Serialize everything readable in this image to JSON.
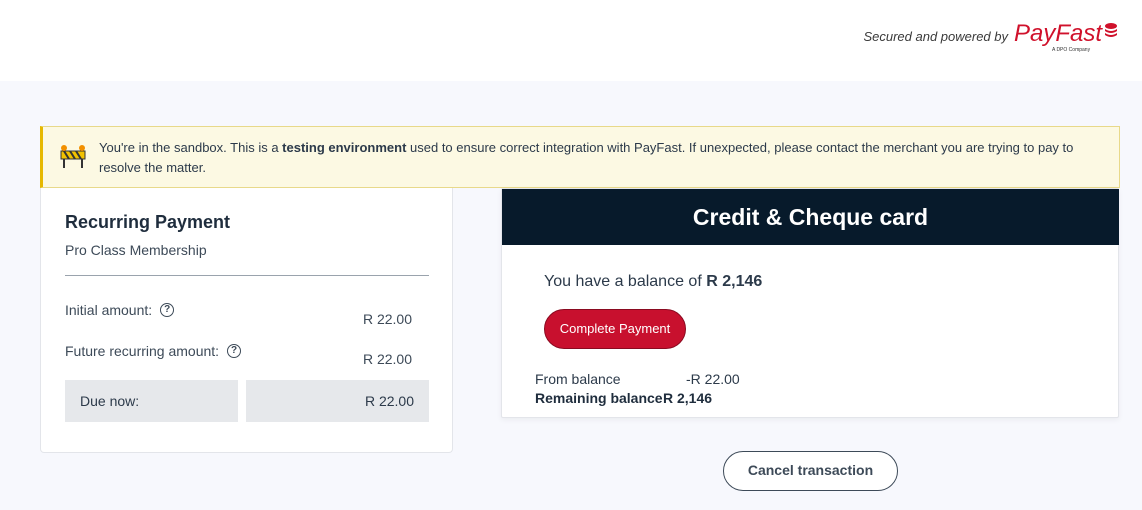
{
  "header": {
    "secured_text": "Secured and powered by",
    "logo_text": "PayFast",
    "logo_subtext": "A DPO Company",
    "brand_color": "#d0112b"
  },
  "sandbox": {
    "text_pre": "You're in the sandbox. This is a ",
    "text_bold": "testing environment",
    "text_post": " used to ensure correct integration with PayFast. If unexpected, please contact the merchant you are trying to pay to resolve the matter.",
    "icon": "barrier-icon"
  },
  "summary": {
    "title": "Recurring Payment",
    "subtitle": "Pro Class Membership",
    "initial_label": "Initial amount:",
    "initial_value": "R 22.00",
    "future_label": "Future recurring amount:",
    "future_value": "R 22.00",
    "due_label": "Due now:",
    "due_value": "R 22.00",
    "help_icon": "question-circle-icon"
  },
  "payment": {
    "header": "Credit & Cheque card",
    "balance_prefix": "You have a balance of ",
    "balance_amount": "R 2,146",
    "complete_button": "Complete Payment",
    "from_balance_label": "From balance",
    "from_balance_value": "-R 22.00",
    "remaining_label": "Remaining balance",
    "remaining_value": "R 2,146",
    "header_color": "#071a2b",
    "button_color": "#c8102e"
  },
  "cancel_button": "Cancel transaction"
}
